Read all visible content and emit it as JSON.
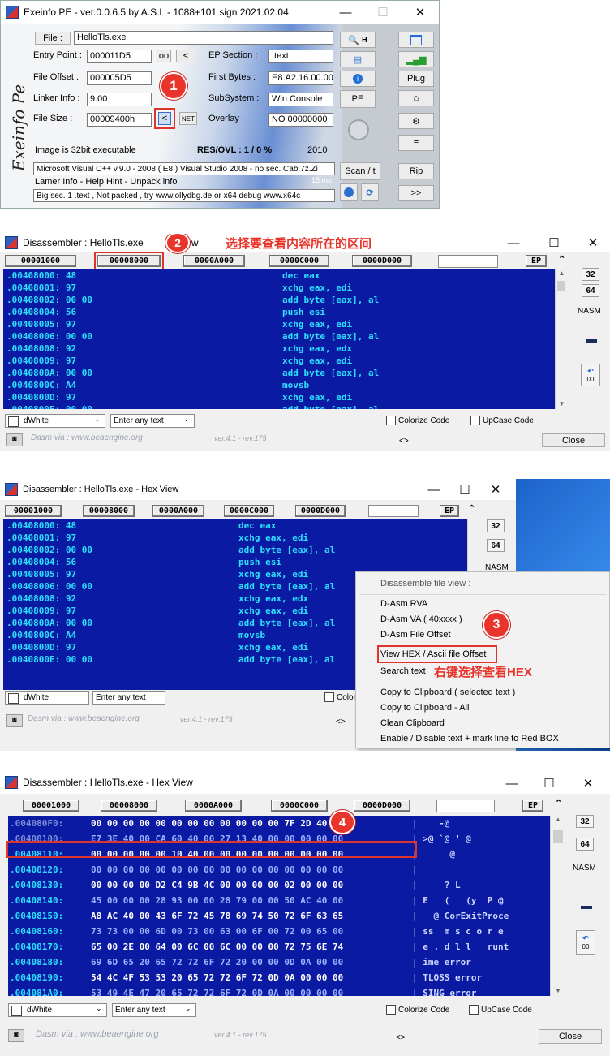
{
  "p1": {
    "title": "Exeinfo PE - ver.0.0.6.5  by A.S.L -  1088+101 sign  2021.02.04",
    "file_btn": "File :",
    "file_name": "HelloTls.exe",
    "entry_point_label": "Entry Point :",
    "entry_point": "000011D5",
    "oo_btn": "oo",
    "lt_btn": "<",
    "ep_section_label": "EP Section :",
    "ep_section": ".text",
    "file_offset_label": "File Offset :",
    "file_offset": "000005D5",
    "first_bytes_label": "First Bytes :",
    "first_bytes": "E8.A2.16.00.00",
    "linker_label": "Linker Info :",
    "linker": "9.00",
    "subsystem_label": "SubSystem :",
    "subsystem": "Win Console",
    "file_size_label": "File Size :",
    "file_size": "00009400h",
    "net_btn": "NET",
    "size_btn": "<",
    "overlay_label": "Overlay :",
    "overlay": "NO  00000000",
    "image_info": "Image is 32bit executable",
    "res_ovl": "RES/OVL : 1 / 0 %",
    "year": "2010",
    "detect": "Microsoft Visual C++ v.9.0 - 2008 ( E8 ) Visual Studio 2008 - no sec. Cab.7z.Zi",
    "lamer": "Lamer Info - Help Hint - Unpack info",
    "ms": "15 ms.",
    "hint": "Big sec. 1 .text , Not packed , try  www.ollydbg.de or x64 debug www.x64c",
    "h_btn": "H",
    "pe_btn": "PE",
    "plug_btn": "Plug",
    "scan_btn": "Scan / t",
    "rip_btn": "Rip",
    "more_btn": ">>",
    "vertical_logo": "Exeinfo Pe",
    "step": "1"
  },
  "p2": {
    "title": "Disassembler :  HelloTls.exe",
    "title_tail": "View",
    "annotation": "选择要查看内容所在的区间",
    "step": "2",
    "sections": [
      "00001000",
      "00008000",
      "0000A000",
      "0000C000",
      "0000D000"
    ],
    "ep": "EP",
    "lines": [
      [
        ".00408000: 48",
        "dec eax"
      ],
      [
        ".00408001: 97",
        "xchg eax, edi"
      ],
      [
        ".00408002: 00 00",
        "add byte [eax], al"
      ],
      [
        ".00408004: 56",
        "push esi"
      ],
      [
        ".00408005: 97",
        "xchg eax, edi"
      ],
      [
        ".00408006: 00 00",
        "add byte [eax], al"
      ],
      [
        ".00408008: 92",
        "xchg eax, edx"
      ],
      [
        ".00408009: 97",
        "xchg eax, edi"
      ],
      [
        ".0040800A: 00 00",
        "add byte [eax], al"
      ],
      [
        ".0040800C: A4",
        "movsb"
      ],
      [
        ".0040800D: 97",
        "xchg eax, edi"
      ],
      [
        ".0040800E: 00 00",
        "add byte [eax], al"
      ]
    ],
    "b32": "32",
    "b64": "64",
    "nasm": "NASM",
    "b00": "00",
    "theme": "dWhite",
    "filter": "Enter any text",
    "colorize": "Colorize Code",
    "upcase": "UpCase Code",
    "dasm_via": "Dasm via  :  www.beaengine.org",
    "ver": "ver.4.1 - rev.175",
    "nav": "<>",
    "close": "Close"
  },
  "p3": {
    "title": "Disassembler :  HelloTls.exe  - Hex View",
    "menu_header": "Disassemble file view :",
    "menu_items": [
      "D-Asm RVA",
      "D-Asm VA ( 40xxxx )",
      "D-Asm File Offset",
      "View HEX / Ascii  file Offset",
      "Search text",
      "Copy to Clipboard ( selected text )",
      "Copy to Clipboard - All",
      "Clean Clipboard",
      "Enable / Disable text + mark line to Red BOX"
    ],
    "annotation": "右键选择查看HEX",
    "step": "3",
    "colori": "Colori"
  },
  "p4": {
    "title": "Disassembler :  HelloTls.exe  - Hex View",
    "step": "4",
    "lines": [
      [
        ".004080F0:",
        "00 00 00 00 00 00 00 00 00 00 00 00 7F 2D 40 00",
        "|    -@"
      ],
      [
        ".00408100:",
        "E7 3E 40 00 CA 60 40 00 27 13 40 00 00 00 00 00",
        "| >@ `@ ' @"
      ],
      [
        ".00408110:",
        "00 00 00 00 00 10 40 00 00 00 00 00 00 00 00 00",
        "|      @"
      ],
      [
        ".00408120:",
        "00 00 00 00 00 00 00 00 00 00 00 00 00 00 00 00",
        "|"
      ],
      [
        ".00408130:",
        "00 00 00 00 D2 C4 9B 4C 00 00 00 00 02 00 00 00",
        "|     ? L"
      ],
      [
        ".00408140:",
        "45 00 00 00 28 93 00 00 28 79 00 00 50 AC 40 00",
        "| E   (   (y  P @"
      ],
      [
        ".00408150:",
        "A8 AC 40 00 43 6F 72 45 78 69 74 50 72 6F 63 65",
        "|   @ CorExitProce"
      ],
      [
        ".00408160:",
        "73 73 00 00 6D 00 73 00 63 00 6F 00 72 00 65 00",
        "| ss  m s c o r e"
      ],
      [
        ".00408170:",
        "65 00 2E 00 64 00 6C 00 6C 00 00 00 72 75 6E 74",
        "| e . d l l   runt"
      ],
      [
        ".00408180:",
        "69 6D 65 20 65 72 72 6F 72 20 00 00 0D 0A 00 00",
        "| ime error"
      ],
      [
        ".00408190:",
        "54 4C 4F 53 53 20 65 72 72 6F 72 0D 0A 00 00 00",
        "| TLOSS error"
      ],
      [
        ".004081A0:",
        "53 49 4E 47 20 65 72 72 6F 72 0D 0A 00 00 00 00",
        "| SING error"
      ]
    ]
  },
  "colors": {
    "dis_bg": "#0a1aa3",
    "dis_text": "#2ce0ff",
    "annot_red": "#e8342a"
  }
}
